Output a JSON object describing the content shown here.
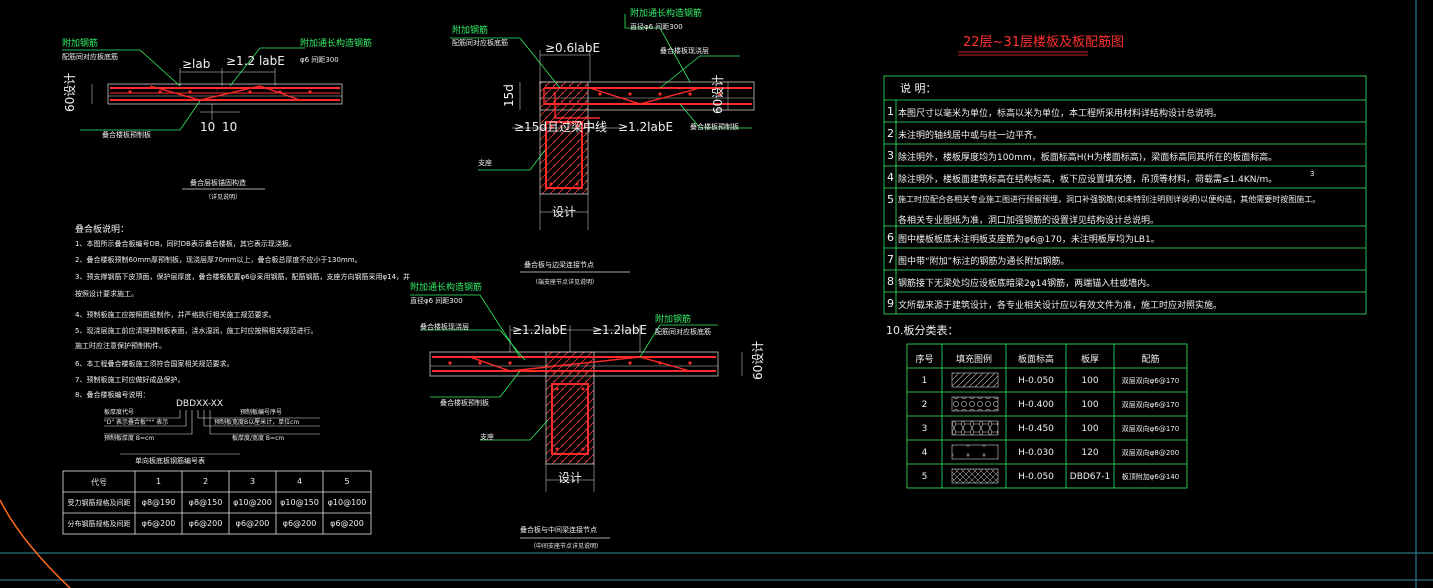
{
  "drawing": {
    "title": "22层~31层楼板及板配筋图",
    "colors": {
      "background": "#000000",
      "rebar": "#ff2a2a",
      "leader": "#33ee66",
      "text": "#f0f0f0",
      "title": "#ff3030",
      "table_line": "#33ee66",
      "boundary": "#ff6a1a",
      "hatch": "#ff4040"
    }
  },
  "detail1": {
    "callout_left_top": "附加钢筋",
    "callout_left_sub": "配筋同对应板底筋",
    "dim_lab": "≥lab",
    "dim_12": "≥1.2 labE",
    "callout_right_top": "附加通长构造钢筋",
    "callout_right_sub": "φ6 间距300",
    "dim_60": "60设计",
    "dim_10a": "10",
    "dim_10b": "10",
    "callout_bottom": "叠合楼板预制板",
    "caption": "叠合层板锚固构造",
    "caption_sub": "（详见说明）"
  },
  "detail2": {
    "callout_top_right": "附加通长构造钢筋",
    "callout_top_right_sub": "直径φ6 间距300",
    "callout_top_left": "附加钢筋",
    "callout_top_left_sub": "配筋同对应板底筋",
    "dim_06": "≥0.6labE",
    "callout_right": "叠合楼板现浇层",
    "dim_15d": "15d",
    "dim_60": "60设计",
    "dim_bottom": "≥15d且过梁中线",
    "dim_12": "≥1.2labE",
    "callout_right_bottom": "叠合楼板预制板",
    "label_beam": "支座",
    "dim_design": "设计",
    "caption": "叠合板与边梁连接节点",
    "caption_sub": "（端支座节点详见说明）"
  },
  "detail3": {
    "callout_a": "附加通长构造钢筋",
    "callout_a_sub": "直径φ6 间距300",
    "callout_b": "叠合楼板现浇层",
    "dim_left": "≥1.2labE",
    "dim_right": "≥1.2labE",
    "callout_c": "附加钢筋",
    "callout_c_sub": "配筋同对应板底筋",
    "dim_60": "60设计",
    "callout_d": "叠合楼板预制板",
    "label_beam": "支座",
    "dim_design": "设计",
    "caption": "叠合板与中间梁连接节点",
    "caption_sub": "（中间支座节点详见说明）"
  },
  "left_notes": {
    "heading": "叠合板说明：",
    "lines": [
      "1、本图所示叠合板编号DB，同时DB表示叠合楼板，其它表示现浇板。",
      "2、叠合楼板预制60mm厚预制板，现浇层厚70mm以上，叠合板总厚度不应小于130mm。",
      "3、预支撑钢筋下皮顶面，保护层厚度，叠合楼板配置φ6@采用钢筋，配筋钢筋，支座方向钢筋采用φ14，并",
      "   按照设计要求施工。",
      "4、预制板施工应按照图纸制作，并严格执行相关施工规范要求。",
      "5、现浇层施工前应清理预制板表面，浇水湿润，施工时应按照相关规范进行。",
      "   施工时应注意保护预制构件。",
      "6、本工程叠合楼板施工须符合国家相关规范要求。",
      "7、预制板施工时应做好成品保护。",
      "8、叠合楼板编号说明："
    ]
  },
  "code_legend": {
    "code": "DBDXX-XX",
    "left_top": "板厚度代号",
    "left_mid": "\"D\" 表示叠合板\"\"\" 表示",
    "left_bot": "预制板厚度 B=cm",
    "right_top": "预制板编号序号",
    "right_mid": "预制板宽度B以厘米计，单位cm",
    "right_bot": "板厚度/宽度 B=cm",
    "caption": "单向板底板钢筋编号表"
  },
  "bottom_table": {
    "headers": [
      "代号",
      "1",
      "2",
      "3",
      "4",
      "5"
    ],
    "rows": [
      [
        "受力钢筋规格及间距",
        "φ8@190",
        "φ8@150",
        "φ10@200",
        "φ10@150",
        "φ10@100"
      ],
      [
        "分布钢筋规格及间距",
        "φ6@200",
        "φ6@200",
        "φ6@200",
        "φ6@200",
        "φ6@200"
      ]
    ]
  },
  "notes": {
    "heading": "说  明：",
    "items": [
      {
        "num": "1",
        "text": "本图尺寸以毫米为单位，标高以米为单位，本工程所采用材料详结构设计总说明。"
      },
      {
        "num": "2",
        "text": "未注明的轴线居中或与柱一边平齐。"
      },
      {
        "num": "3",
        "text": "除注明外，楼板厚度均为100mm，板面标高H(H为楼面标高)，梁面标高同其所在的板面标高。"
      },
      {
        "num": "4",
        "text": "除注明外，楼板面建筑标高在结构标高，板下应设置填充墙，吊顶等材料，荷载需≤1.4KN/m。"
      },
      {
        "num": "5",
        "text": "施工时应配合各相关专业施工图进行预留预埋，洞口补强钢筋(如未特别注明则详说明)以便构造，其他需要时按图施工。"
      },
      {
        "num": "",
        "text": "各相关专业图纸为准，洞口加强钢筋的设置详见结构设计总说明。"
      },
      {
        "num": "6",
        "text": "图中楼板板底未注明板支座筋为φ6@170，未注明板厚均为LB1。"
      },
      {
        "num": "7",
        "text": "图中带“附加”标注的钢筋为通长附加钢筋。"
      },
      {
        "num": "8",
        "text": "钢筋接下无梁处均应设板底暗梁2φ14钢筋，两端锚入柱或墙内。"
      },
      {
        "num": "9",
        "text": "文所载来源于建筑设计，各专业相关设计应以有效文件为准，施工时应对照实施。"
      }
    ],
    "item10": "10.板分类表："
  },
  "type_table": {
    "headers": [
      "序号",
      "填充图例",
      "板面标高",
      "板厚",
      "配筋"
    ],
    "rows": [
      {
        "no": "1",
        "pattern": "hatch-diag",
        "level": "H-0.050",
        "thick": "100",
        "rebar": "双层双向φ6@170"
      },
      {
        "no": "2",
        "pattern": "hatch-circles",
        "level": "H-0.400",
        "thick": "100",
        "rebar": "双层双向φ6@170"
      },
      {
        "no": "3",
        "pattern": "hatch-hex",
        "level": "H-0.450",
        "thick": "100",
        "rebar": "双层双向φ6@170"
      },
      {
        "no": "4",
        "pattern": "hatch-plus",
        "level": "H-0.030",
        "thick": "120",
        "rebar": "双层双向φ8@200"
      },
      {
        "no": "5",
        "pattern": "hatch-cross",
        "level": "H-0.050",
        "thick": "DBD67-1",
        "rebar": "板顶附加φ6@140"
      }
    ]
  },
  "misc": {
    "small_mark": "3"
  }
}
